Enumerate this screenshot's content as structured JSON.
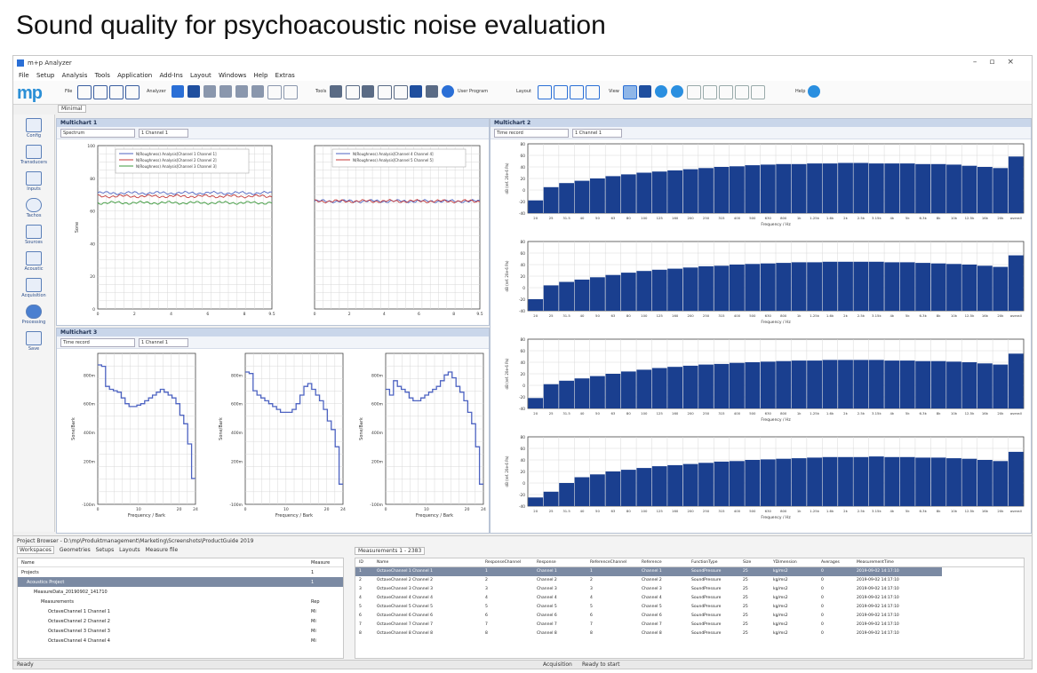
{
  "heading": "Sound quality for psychoacoustic noise evaluation",
  "app": {
    "title": "m+p Analyzer",
    "menu": [
      "File",
      "Setup",
      "Analysis",
      "Tools",
      "Application",
      "Add-Ins",
      "Layout",
      "Windows",
      "Help",
      "Extras"
    ],
    "toolbar_groups": [
      "File",
      "Analyzer",
      "Tools",
      "User Program",
      "Layout",
      "View",
      "Help"
    ],
    "user_program_label": "User Program",
    "sub_tab": "Minimal",
    "sidebar": [
      {
        "label": "Config",
        "icon": "config-icon"
      },
      {
        "label": "Transducers",
        "icon": "transducer-icon"
      },
      {
        "label": "Inputs",
        "icon": "inputs-icon"
      },
      {
        "label": "Tachos",
        "icon": "tacho-icon"
      },
      {
        "label": "Sources",
        "icon": "sources-icon"
      },
      {
        "label": "Acoustic",
        "icon": "speaker-icon"
      },
      {
        "label": "Acquisition",
        "icon": "acquisition-icon"
      },
      {
        "label": "Processing",
        "icon": "processing-icon"
      },
      {
        "label": "Save",
        "icon": "save-icon"
      }
    ],
    "panels": {
      "p1": {
        "title": "Multichart 1",
        "dropdown": "Spectrum",
        "channel": "1 Channel 1"
      },
      "p2": {
        "title": "Multichart 2",
        "dropdown": "Time record",
        "channel": "1 Channel 1"
      },
      "p3": {
        "title": "Multichart 3",
        "dropdown": "Time record",
        "channel": "1 Channel 1"
      }
    },
    "project_path": "Project Browser - D:\\mp\\Produktmanagement\\Marketing\\Screenshots\\ProductGuide 2019",
    "project_tabs": [
      "Workspaces",
      "Geometries",
      "Setups",
      "Layouts",
      "Measure file"
    ],
    "tree_columns": [
      "Name",
      "Measure"
    ],
    "tree_rows": [
      {
        "label": "Projects",
        "value": "1"
      },
      {
        "label": "Acoustics Project",
        "value": "1"
      },
      {
        "label": "MeasureData_20190902_141710",
        "value": ""
      },
      {
        "label": "Measurements",
        "value": "Rep"
      },
      {
        "label": "OctaveChannel 1 Channel 1",
        "value": "Mi"
      },
      {
        "label": "OctaveChannel 2 Channel 2",
        "value": "Mi"
      },
      {
        "label": "OctaveChannel 3 Channel 3",
        "value": "Mi"
      },
      {
        "label": "OctaveChannel 4 Channel 4",
        "value": "Mi"
      }
    ],
    "meas_title": "Measurements 1 - 2383",
    "meas_columns": [
      "ID",
      "Name",
      "ResponseChannel",
      "Response",
      "ReferenceChannel",
      "Reference",
      "FunctionType",
      "Size",
      "YDimension",
      "Averages",
      "MeasurementTime"
    ],
    "meas_rows": [
      [
        "1",
        "OctaveChannel 1 Channel 1",
        "1",
        "Channel 1",
        "1",
        "Channel 1",
        "SoundPressure",
        "25",
        "kg/ms2",
        "0",
        "2019-09-02 14:17:10"
      ],
      [
        "2",
        "OctaveChannel 2 Channel 2",
        "2",
        "Channel 2",
        "2",
        "Channel 2",
        "SoundPressure",
        "25",
        "kg/ms2",
        "0",
        "2019-09-02 14:17:10"
      ],
      [
        "3",
        "OctaveChannel 3 Channel 3",
        "3",
        "Channel 3",
        "3",
        "Channel 3",
        "SoundPressure",
        "25",
        "kg/ms2",
        "0",
        "2019-09-02 14:17:10"
      ],
      [
        "4",
        "OctaveChannel 4 Channel 4",
        "4",
        "Channel 4",
        "4",
        "Channel 4",
        "SoundPressure",
        "25",
        "kg/ms2",
        "0",
        "2019-09-02 14:17:10"
      ],
      [
        "5",
        "OctaveChannel 5 Channel 5",
        "5",
        "Channel 5",
        "5",
        "Channel 5",
        "SoundPressure",
        "25",
        "kg/ms2",
        "0",
        "2019-09-02 14:17:10"
      ],
      [
        "6",
        "OctaveChannel 6 Channel 6",
        "6",
        "Channel 6",
        "6",
        "Channel 6",
        "SoundPressure",
        "25",
        "kg/ms2",
        "0",
        "2019-09-02 14:17:10"
      ],
      [
        "7",
        "OctaveChannel 7 Channel 7",
        "7",
        "Channel 7",
        "7",
        "Channel 7",
        "SoundPressure",
        "25",
        "kg/ms2",
        "0",
        "2019-09-02 14:17:10"
      ],
      [
        "8",
        "OctaveChannel 8 Channel 8",
        "8",
        "Channel 8",
        "8",
        "Channel 8",
        "SoundPressure",
        "25",
        "kg/ms2",
        "0",
        "2019-09-02 14:17:10"
      ]
    ],
    "status_left": "Ready",
    "status_acq": "Acquisition",
    "status_ready": "Ready to start"
  },
  "chart_data": [
    {
      "type": "line",
      "id": "loudness-left",
      "ylabel": "Sone",
      "ylim": [
        0,
        100
      ],
      "yticks": [
        0,
        20,
        40,
        60,
        80,
        100
      ],
      "xlim": [
        0,
        9.5
      ],
      "xticks": [
        0,
        2,
        4,
        6,
        8,
        9.5
      ],
      "series": [
        {
          "name": "N(Roughness) Analysis[Channel 1 Channel 1]",
          "color": "#4d63c2",
          "level": 71
        },
        {
          "name": "N(Roughness) Analysis[Channel 2 Channel 2]",
          "color": "#c43a3a",
          "level": 69
        },
        {
          "name": "N(Roughness) Analysis[Channel 3 Channel 3]",
          "color": "#3c9a3c",
          "level": 65
        }
      ]
    },
    {
      "type": "line",
      "id": "loudness-right",
      "ylim": [
        0,
        100
      ],
      "xlim": [
        0,
        9.5
      ],
      "xticks": [
        0,
        2,
        4,
        6,
        8,
        9.5
      ],
      "series": [
        {
          "name": "N(Roughness) Analysis[Channel 4 Channel 4]",
          "color": "#4d63c2",
          "level": 66
        },
        {
          "name": "N(Roughness) Analysis[Channel 5 Channel 5]",
          "color": "#c43a3a",
          "level": 66
        }
      ]
    },
    {
      "type": "line",
      "id": "specific-loudness",
      "xlabel": "Frequency / Bark",
      "ylabel": "Sone/Bark",
      "xlim": [
        0,
        24
      ],
      "xticks": [
        0,
        10,
        20,
        24
      ],
      "ylim": [
        -100,
        950
      ],
      "ytick_labels": [
        "-100m",
        "200m",
        "400m",
        "600m",
        "800m"
      ],
      "panels": [
        {
          "values": [
            870,
            860,
            720,
            700,
            690,
            680,
            640,
            600,
            580,
            580,
            590,
            600,
            620,
            640,
            660,
            680,
            700,
            680,
            660,
            640,
            600,
            520,
            460,
            320,
            80
          ]
        },
        {
          "values": [
            820,
            810,
            690,
            660,
            640,
            620,
            600,
            580,
            560,
            540,
            540,
            540,
            560,
            600,
            660,
            720,
            740,
            700,
            660,
            620,
            560,
            480,
            420,
            300,
            40
          ]
        },
        {
          "values": [
            700,
            660,
            760,
            720,
            700,
            680,
            640,
            620,
            620,
            640,
            660,
            680,
            700,
            720,
            760,
            800,
            820,
            780,
            720,
            680,
            620,
            540,
            460,
            300,
            40
          ]
        }
      ]
    },
    {
      "type": "bar",
      "id": "third-octave-spectra",
      "xlabel": "Frequency / Hz",
      "ylabel": "dB (ref. 20e-6 Pa)",
      "ylim": [
        -40,
        80
      ],
      "yticks": [
        -40,
        -20,
        0,
        20,
        40,
        60,
        80
      ],
      "categories": [
        "20",
        "25",
        "31.5",
        "40",
        "50",
        "63",
        "80",
        "100",
        "125",
        "160",
        "200",
        "250",
        "315",
        "400",
        "500",
        "630",
        "800",
        "1k",
        "1.25k",
        "1.6k",
        "2k",
        "2.5k",
        "3.15k",
        "4k",
        "5k",
        "6.3k",
        "8k",
        "10k",
        "12.5k",
        "16k",
        "20k",
        "overall"
      ],
      "series": [
        {
          "values": [
            -18,
            5,
            12,
            16,
            20,
            24,
            27,
            30,
            32,
            34,
            36,
            38,
            40,
            41,
            43,
            44,
            45,
            45,
            46,
            46,
            47,
            47,
            46,
            46,
            46,
            45,
            45,
            44,
            42,
            40,
            38,
            58
          ]
        },
        {
          "values": [
            -20,
            4,
            10,
            14,
            18,
            22,
            26,
            29,
            31,
            33,
            35,
            37,
            38,
            40,
            41,
            42,
            43,
            44,
            44,
            45,
            45,
            45,
            45,
            44,
            44,
            43,
            42,
            41,
            40,
            38,
            36,
            56
          ]
        },
        {
          "values": [
            -22,
            2,
            8,
            12,
            16,
            20,
            24,
            27,
            30,
            32,
            34,
            36,
            37,
            39,
            40,
            41,
            42,
            43,
            43,
            44,
            44,
            44,
            44,
            43,
            43,
            42,
            42,
            41,
            40,
            38,
            36,
            55
          ]
        },
        {
          "values": [
            -25,
            -15,
            0,
            10,
            15,
            20,
            23,
            26,
            29,
            31,
            33,
            35,
            37,
            38,
            40,
            41,
            42,
            43,
            44,
            45,
            45,
            45,
            46,
            45,
            45,
            44,
            44,
            43,
            42,
            40,
            38,
            54
          ]
        }
      ]
    }
  ]
}
